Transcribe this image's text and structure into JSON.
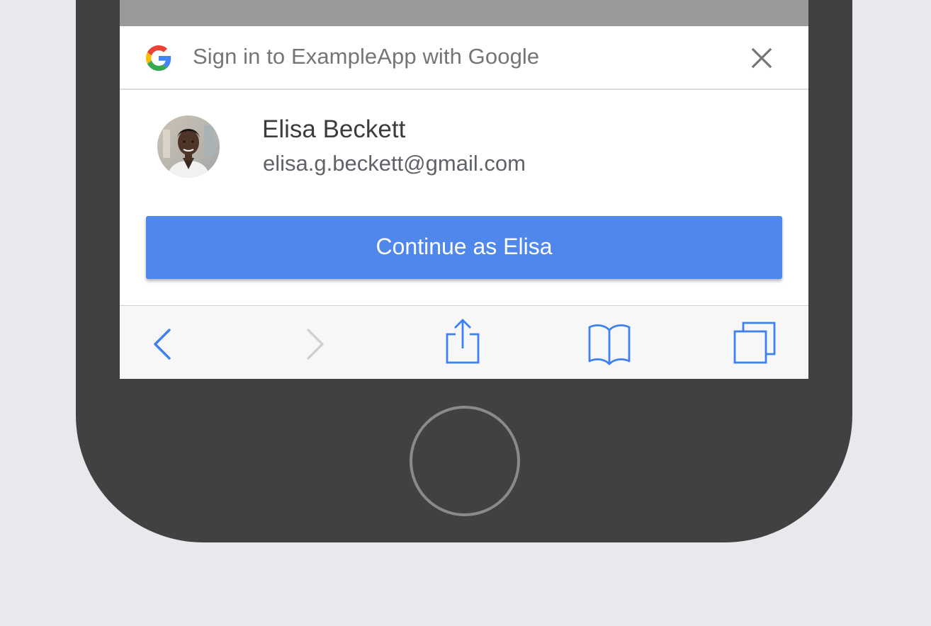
{
  "sign_in_sheet": {
    "title": "Sign in to ExampleApp with Google",
    "account": {
      "name": "Elisa Beckett",
      "email": "elisa.g.beckett@gmail.com"
    },
    "continue_label": "Continue as Elisa"
  },
  "toolbar": {
    "back_icon": "chevron-left-icon",
    "forward_icon": "chevron-right-icon",
    "share_icon": "share-icon",
    "bookmarks_icon": "book-icon",
    "tabs_icon": "tabs-icon"
  },
  "colors": {
    "primary_button": "#5087eb",
    "toolbar_icon": "#3b82f0",
    "toolbar_icon_disabled": "#d0d0d0",
    "phone_body": "#414141",
    "background": "#e8e9ec"
  }
}
